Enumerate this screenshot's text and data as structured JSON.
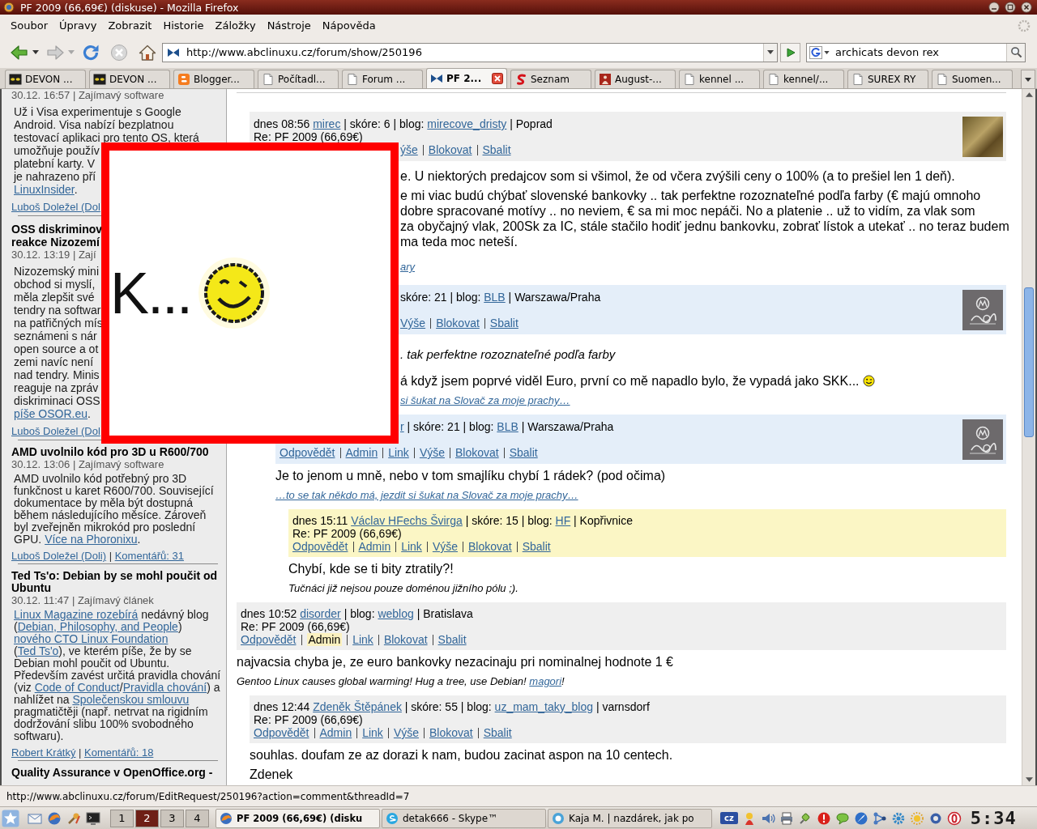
{
  "window": {
    "title": "PF 2009 (66,69€) (diskuse) - Mozilla Firefox"
  },
  "menu": [
    "Soubor",
    "Úpravy",
    "Zobrazit",
    "Historie",
    "Záložky",
    "Nástroje",
    "Nápověda"
  ],
  "nav_buttons": [
    {
      "kind": "back",
      "disabled": false
    },
    {
      "kind": "forward",
      "disabled": true
    },
    {
      "kind": "reload",
      "disabled": false
    },
    {
      "kind": "stop",
      "disabled": true
    },
    {
      "kind": "home",
      "disabled": false
    }
  ],
  "address_field": {
    "value": "http://www.abclinuxu.cz/forum/show/250196"
  },
  "search_field": {
    "value": "archicats devon rex"
  },
  "tabs": [
    {
      "label": "DEVON ...",
      "kind": "eyes",
      "selected": false
    },
    {
      "label": "DEVON ...",
      "kind": "eyes",
      "selected": false
    },
    {
      "label": "Blogger...",
      "kind": "blogger",
      "selected": false
    },
    {
      "label": "Počítadl...",
      "kind": "page",
      "selected": false
    },
    {
      "label": "Forum ...",
      "kind": "page",
      "selected": false
    },
    {
      "label": "PF 2...",
      "kind": "site",
      "selected": true
    },
    {
      "label": "Seznam",
      "kind": "seznam",
      "selected": false
    },
    {
      "label": "August-...",
      "kind": "photo",
      "selected": false
    },
    {
      "label": "kennel ...",
      "kind": "page",
      "selected": false
    },
    {
      "label": "kennel/...",
      "kind": "page",
      "selected": false
    },
    {
      "label": "SUREX RY",
      "kind": "page",
      "selected": false
    },
    {
      "label": "Suomen...",
      "kind": "page",
      "selected": false
    }
  ],
  "sidebar": {
    "items": [
      {
        "meta": "30.12. 16:57 | Zajímavý software",
        "lines": [
          [
            {
              "kind": "text",
              "text": "Už i Visa experimentuje s Google"
            }
          ],
          [
            {
              "kind": "text",
              "text": "Android. Visa nabízí bezplatnou"
            }
          ],
          [
            {
              "kind": "text",
              "text": "testovací aplikaci pro tento OS, která"
            }
          ],
          [
            {
              "kind": "text",
              "text": "umožňuje použív"
            }
          ],
          [
            {
              "kind": "text",
              "text": "platební karty. V"
            }
          ],
          [
            {
              "kind": "text",
              "text": "je nahrazeno pří"
            }
          ],
          [
            {
              "kind": "link",
              "text": "LinuxInsider"
            },
            {
              "kind": "text",
              "text": "."
            }
          ]
        ],
        "footer": [
          {
            "kind": "link",
            "text": "Luboš Doležel (Dol"
          }
        ]
      },
      {
        "title": [
          "OSS diskriminov",
          "reakce Nizozemí"
        ],
        "meta": "30.12. 13:19 | Zají",
        "lines": [
          [
            {
              "kind": "text",
              "text": "Nizozemský mini"
            }
          ],
          [
            {
              "kind": "text",
              "text": "obchod si myslí,"
            }
          ],
          [
            {
              "kind": "text",
              "text": "měla zlepšit své"
            }
          ],
          [
            {
              "kind": "text",
              "text": "tendry na softwar"
            }
          ],
          [
            {
              "kind": "text",
              "text": "na patřičných mís"
            }
          ],
          [
            {
              "kind": "text",
              "text": "seznámeni s nár"
            }
          ],
          [
            {
              "kind": "text",
              "text": "open source a ot"
            }
          ],
          [
            {
              "kind": "text",
              "text": "zemi navíc není"
            }
          ],
          [
            {
              "kind": "text",
              "text": "nad tendry. Minis"
            }
          ],
          [
            {
              "kind": "text",
              "text": "reaguje na zpráv"
            }
          ],
          [
            {
              "kind": "text",
              "text": "diskriminaci OSS"
            }
          ],
          [
            {
              "kind": "link",
              "text": "píše OSOR.eu"
            },
            {
              "kind": "text",
              "text": "."
            }
          ]
        ],
        "footer": [
          {
            "kind": "link",
            "text": "Luboš Doležel (Dol"
          }
        ]
      },
      {
        "title": [
          "AMD uvolnilo kód pro 3D u R600/700"
        ],
        "meta": "30.12. 13:06 | Zajímavý software",
        "text": [
          {
            "kind": "text",
            "text": "AMD uvolnilo kód potřebný pro 3D funkčnost u karet R600/700. Související dokumentace by měla být dostupná během následujícího měsíce. Zároveň byl zveřejněn mikrokód pro poslední GPU. "
          },
          {
            "kind": "link",
            "text": "Více na Phoronixu"
          },
          {
            "kind": "text",
            "text": "."
          }
        ],
        "footer": [
          {
            "kind": "link",
            "text": "Luboš Doležel (Doli)"
          },
          {
            "kind": "text",
            "text": " | "
          },
          {
            "kind": "link",
            "text": "Komentářů: 31"
          }
        ]
      },
      {
        "title": [
          "Ted Ts'o: Debian by se mohl poučit od Ubuntu"
        ],
        "meta": "30.12. 11:47 | Zajímavý článek",
        "text": [
          {
            "kind": "link",
            "text": "Linux Magazine rozebírá"
          },
          {
            "kind": "text",
            "text": " nedávný blog ("
          },
          {
            "kind": "link",
            "text": "Debian, Philosophy, and People"
          },
          {
            "kind": "text",
            "text": ") "
          },
          {
            "kind": "link",
            "text": "nového CTO Linux Foundation"
          },
          {
            "kind": "text",
            "text": " ("
          },
          {
            "kind": "link",
            "text": "Ted Ts'o"
          },
          {
            "kind": "text",
            "text": "), ve kterém píše, že by se Debian mohl poučit od Ubuntu. Především zavést určitá pravidla chování (viz "
          },
          {
            "kind": "link",
            "text": "Code of Conduct"
          },
          {
            "kind": "text",
            "text": "/"
          },
          {
            "kind": "link",
            "text": "Pravidla chování"
          },
          {
            "kind": "text",
            "text": ") a nahlížet na "
          },
          {
            "kind": "link",
            "text": "Společenskou smlouvu"
          },
          {
            "kind": "text",
            "text": " pragmatičtěji (např. netrvat na rigidním dodržování slibu 100% svobodného softwaru)."
          }
        ],
        "footer": [
          {
            "kind": "link",
            "text": "Robert Krátký"
          },
          {
            "kind": "text",
            "text": " | "
          },
          {
            "kind": "link",
            "text": "Komentářů: 18"
          }
        ]
      },
      {
        "title": [
          "Quality Assurance v OpenOffice.org -"
        ]
      }
    ]
  },
  "comments": [
    {
      "color": "#efefef",
      "meta": [
        {
          "kind": "text",
          "text": "dnes 08:56 "
        },
        {
          "kind": "link",
          "text": "mirec"
        },
        {
          "kind": "text",
          "text": " | skóre: 6 | blog: "
        },
        {
          "kind": "link",
          "text": "mirecove_dristy"
        },
        {
          "kind": "text",
          "text": " | Poprad"
        }
      ],
      "title": "Re: PF 2009 (66,69€)",
      "actions": [
        {
          "label": "ýše",
          "hovered": false
        },
        {
          "label": "Blokovat",
          "hovered": false
        },
        {
          "label": "Sbalit",
          "hovered": false
        }
      ],
      "avatar": {
        "kind": "photo"
      },
      "body": [
        {
          "kind": "plain",
          "segments": [
            {
              "kind": "text",
              "text": "e. U niektorých predajcov som si všimol, že od včera zvýšili ceny o 100% (a to prešiel len 1 deň)."
            }
          ]
        },
        {
          "kind": "plain",
          "segments": [
            {
              "kind": "text",
              "text": "e mi viac budú chýbať slovenské bankovky .. tak perfektne rozoznateľné podľa farby (€ majú omnoho\ndobre spracované motívy .. no neviem, € sa mi moc nepáči. No a platenie .. už to vidím, za vlak som\nza obyčajný vlak, 200Sk za IC, stále stačilo hodiť jednu bankovku, zobrať lístok a utekať .. no teraz budem\nma teda moc neteší."
            }
          ]
        }
      ],
      "signature": [
        {
          "kind": "link",
          "text": "ary"
        }
      ],
      "children": [
        {
          "color": "#e4eef9",
          "meta": [
            {
              "kind": "text",
              "text": "skóre: 21 | blog: "
            },
            {
              "kind": "link",
              "text": "BLB"
            },
            {
              "kind": "text",
              "text": " | Warszawa/Praha"
            }
          ],
          "actions": [
            {
              "label": "Výše",
              "hovered": false
            },
            {
              "label": "Blokovat",
              "hovered": false
            },
            {
              "label": "Sbalit",
              "hovered": false
            }
          ],
          "avatar": {
            "kind": "logo"
          },
          "body": [
            {
              "kind": "quote",
              "segments": [
                {
                  "kind": "text",
                  "text": ". tak perfektne rozoznateľné podľa farby"
                }
              ]
            },
            {
              "kind": "plain",
              "segments": [
                {
                  "kind": "text",
                  "text": "á když jsem poprvé viděl Euro, první co mě napadlo bylo, že vypadá jako SKK... "
                },
                {
                  "kind": "smiley"
                }
              ]
            }
          ],
          "signature": [
            {
              "kind": "link",
              "text": "si šukat na Slovač za moje prachy…"
            }
          ],
          "children": [
            {
              "color": "#e4eef9",
              "meta": [
                {
                  "kind": "link",
                  "text": "r"
                },
                {
                  "kind": "text",
                  "text": " | skóre: 21 | blog: "
                },
                {
                  "kind": "link",
                  "text": "BLB"
                },
                {
                  "kind": "text",
                  "text": " | Warszawa/Praha"
                }
              ],
              "actions": [
                {
                  "label": "Odpovědět",
                  "hovered": false
                },
                {
                  "label": "Admin",
                  "hovered": false
                },
                {
                  "label": "Link",
                  "hovered": false
                },
                {
                  "label": "Výše",
                  "hovered": false
                },
                {
                  "label": "Blokovat",
                  "hovered": false
                },
                {
                  "label": "Sbalit",
                  "hovered": false
                }
              ],
              "avatar": {
                "kind": "logo"
              },
              "body": [
                {
                  "kind": "plain",
                  "segments": [
                    {
                      "kind": "text",
                      "text": "Je to jenom u mně, nebo v tom smajlíku chybí 1 rádek? (pod očima)"
                    }
                  ]
                }
              ],
              "signature": [
                {
                  "kind": "link",
                  "text": "…to se tak někdo má, jezdit si šukat na Slovač za moje prachy…"
                }
              ],
              "children": [
                {
                  "color": "#fbf6c5",
                  "meta": [
                    {
                      "kind": "text",
                      "text": "dnes 15:11 "
                    },
                    {
                      "kind": "link",
                      "text": "Václav HFechs Švirga"
                    },
                    {
                      "kind": "text",
                      "text": " | skóre: 15 | blog: "
                    },
                    {
                      "kind": "link",
                      "text": "HF"
                    },
                    {
                      "kind": "text",
                      "text": " | Kopřivnice"
                    }
                  ],
                  "title": "Re: PF 2009 (66,69€)",
                  "actions": [
                    {
                      "label": "Odpovědět",
                      "hovered": false
                    },
                    {
                      "label": "Admin",
                      "hovered": false
                    },
                    {
                      "label": "Link",
                      "hovered": false
                    },
                    {
                      "label": "Výše",
                      "hovered": false
                    },
                    {
                      "label": "Blokovat",
                      "hovered": false
                    },
                    {
                      "label": "Sbalit",
                      "hovered": false
                    }
                  ],
                  "body": [
                    {
                      "kind": "plain",
                      "segments": [
                        {
                          "kind": "text",
                          "text": "Chybí, kde se ti bity ztratily?!"
                        }
                      ]
                    }
                  ],
                  "signature": [
                    {
                      "kind": "text",
                      "text": "Tučnáci již nejsou pouze doménou jižního pólu ;)."
                    }
                  ]
                }
              ]
            }
          ]
        }
      ]
    },
    {
      "color": "#efefef",
      "meta": [
        {
          "kind": "text",
          "text": "dnes 10:52 "
        },
        {
          "kind": "link",
          "text": "disorder"
        },
        {
          "kind": "text",
          "text": " | blog: "
        },
        {
          "kind": "link",
          "text": "weblog"
        },
        {
          "kind": "text",
          "text": " | Bratislava"
        }
      ],
      "title": "Re: PF 2009 (66,69€)",
      "actions": [
        {
          "label": "Odpovědět",
          "hovered": false
        },
        {
          "label": "Admin",
          "hovered": true
        },
        {
          "label": "Link",
          "hovered": false
        },
        {
          "label": "Blokovat",
          "hovered": false
        },
        {
          "label": "Sbalit",
          "hovered": false
        }
      ],
      "body": [
        {
          "kind": "plain",
          "segments": [
            {
              "kind": "text",
              "text": "najvacsia chyba je, ze euro bankovky nezacinaju pri nominalnej hodnote 1 €"
            }
          ]
        }
      ],
      "signature": [
        {
          "kind": "text",
          "text": "Gentoo Linux causes global warming! Hug a tree, use Debian! "
        },
        {
          "kind": "link",
          "text": "magori"
        },
        {
          "kind": "text",
          "text": "!"
        }
      ],
      "children": [
        {
          "color": "#efefef",
          "meta": [
            {
              "kind": "text",
              "text": "dnes 12:44 "
            },
            {
              "kind": "link",
              "text": "Zdeněk Štěpánek"
            },
            {
              "kind": "text",
              "text": " | skóre: 55 | blog: "
            },
            {
              "kind": "link",
              "text": "uz_mam_taky_blog"
            },
            {
              "kind": "text",
              "text": " | varnsdorf"
            }
          ],
          "title": "Re: PF 2009 (66,69€)",
          "actions": [
            {
              "label": "Odpovědět",
              "hovered": false
            },
            {
              "label": "Admin",
              "hovered": false
            },
            {
              "label": "Link",
              "hovered": false
            },
            {
              "label": "Výše",
              "hovered": false
            },
            {
              "label": "Blokovat",
              "hovered": false
            },
            {
              "label": "Sbalit",
              "hovered": false
            }
          ],
          "body": [
            {
              "kind": "plain",
              "segments": [
                {
                  "kind": "text",
                  "text": "souhlas. doufam ze az dorazi k nam, budou zacinat aspon na 10 centech."
                }
              ]
            },
            {
              "kind": "plain",
              "segments": [
                {
                  "kind": "text",
                  "text": "Zdenek"
                }
              ]
            }
          ]
        }
      ]
    }
  ],
  "popup": {
    "text": "K..."
  },
  "status_bar": {
    "text": "http://www.abclinuxu.cz/forum/EditRequest/250196?action=comment&threadId=7"
  },
  "taskbar": {
    "workspaces": [
      {
        "label": "1",
        "selected": false
      },
      {
        "label": "2",
        "selected": true
      },
      {
        "label": "3",
        "selected": false
      },
      {
        "label": "4",
        "selected": false
      }
    ],
    "tasks": [
      {
        "label": "PF 2009 (66,69€) (disku",
        "kind": "browser",
        "selected": true
      },
      {
        "label": "detak666 - Skype™",
        "kind": "skype",
        "selected": false
      },
      {
        "label": "Kaja M. | nazdárek, jak po",
        "kind": "chat",
        "selected": false
      }
    ],
    "keyboard_layout": "cz",
    "clock": "5:34"
  }
}
